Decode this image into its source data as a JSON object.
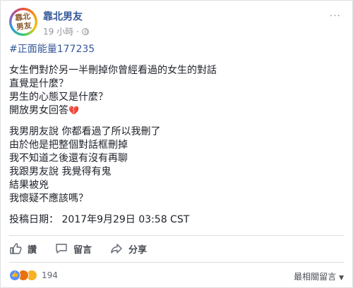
{
  "post": {
    "author": "靠北男友",
    "avatar_text": "靠北男友",
    "time": "19 小時",
    "hashtag": "#正面能量177235",
    "para1": [
      "女生們對於另一半刪掉你曾經看過的女生的對話",
      "直覺是什麼？",
      "男生的心態又是什麼？",
      "開放男女回答"
    ],
    "para2": [
      "我男朋友說 你都看過了所以我刪了",
      "由於他是把整個對話框刪掉",
      "我不知道之後還有沒有再聊",
      "我跟男友說 我覺得有鬼",
      "結果被兇",
      "我懷疑不應該嗎？"
    ],
    "post_date": "投稿日期： 2017年9月29日 03:58 CST"
  },
  "actions": {
    "like": "讚",
    "comment": "留言",
    "share": "分享"
  },
  "reactions": {
    "count": "194",
    "sort": "最相關留言"
  }
}
